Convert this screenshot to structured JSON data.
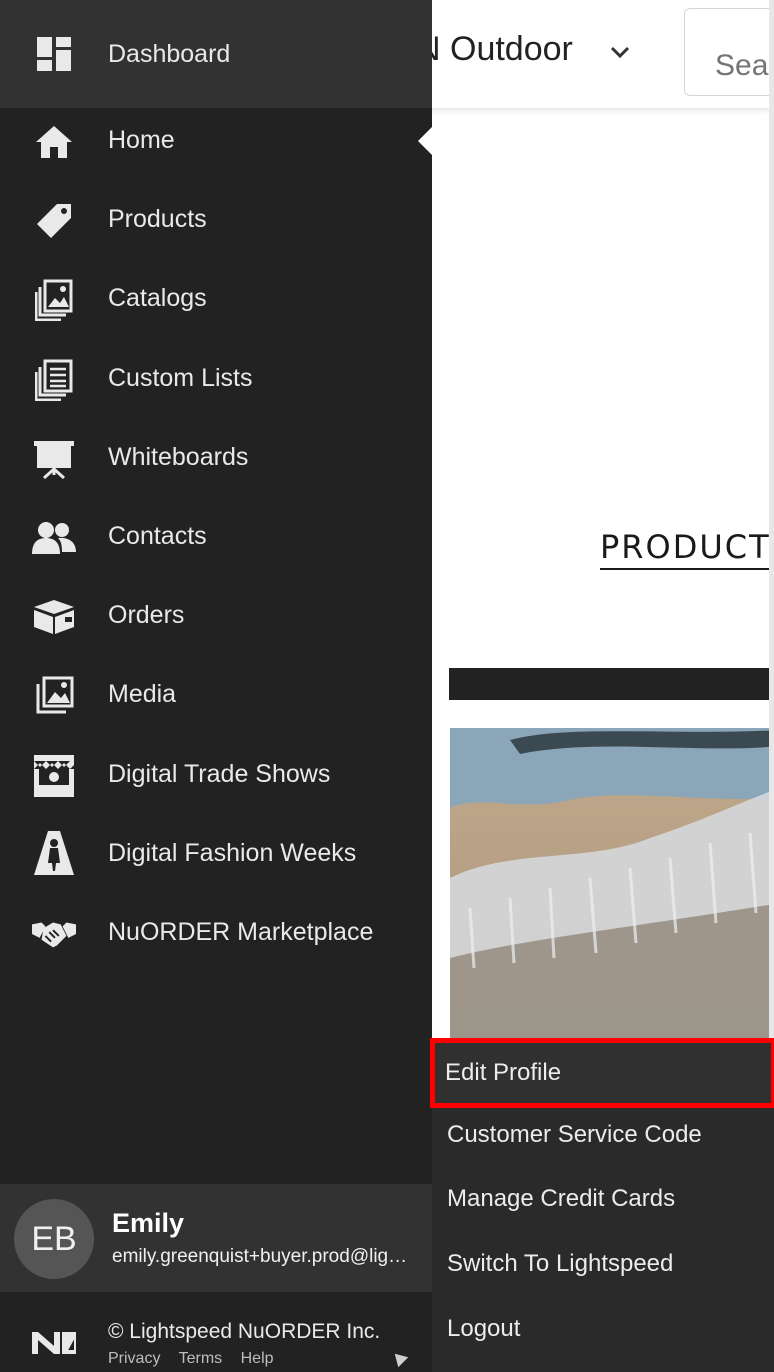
{
  "app": {
    "brand_title": "N Outdoor",
    "search_placeholder": "Search",
    "products_link": "PRODUCT",
    "colors": {
      "sidebar_bg": "#222222",
      "active_bg": "#323232",
      "menu_bg": "#2a2a2a",
      "highlight": "#ff0000"
    }
  },
  "sidebar": {
    "items": [
      {
        "label": "Dashboard",
        "icon": "dashboard-icon",
        "active": true
      },
      {
        "label": "Home",
        "icon": "home-icon"
      },
      {
        "label": "Products",
        "icon": "tag-icon"
      },
      {
        "label": "Catalogs",
        "icon": "catalog-icon"
      },
      {
        "label": "Custom Lists",
        "icon": "list-icon"
      },
      {
        "label": "Whiteboards",
        "icon": "whiteboard-icon"
      },
      {
        "label": "Contacts",
        "icon": "contacts-icon"
      },
      {
        "label": "Orders",
        "icon": "box-icon"
      },
      {
        "label": "Media",
        "icon": "media-icon"
      },
      {
        "label": "Digital Trade Shows",
        "icon": "booth-icon"
      },
      {
        "label": "Digital Fashion Weeks",
        "icon": "runway-icon"
      },
      {
        "label": "NuORDER Marketplace",
        "icon": "handshake-icon"
      }
    ]
  },
  "user": {
    "initials": "EB",
    "name": "Emily",
    "email": "emily.greenquist+buyer.prod@lightspeedhq.com"
  },
  "footer": {
    "copyright": "© Lightspeed NuORDER Inc.",
    "links": [
      "Privacy",
      "Terms",
      "Help"
    ]
  },
  "user_menu": {
    "items": [
      "Edit Profile",
      "Customer Service Code",
      "Manage Credit Cards",
      "Switch To Lightspeed",
      "Logout"
    ]
  }
}
